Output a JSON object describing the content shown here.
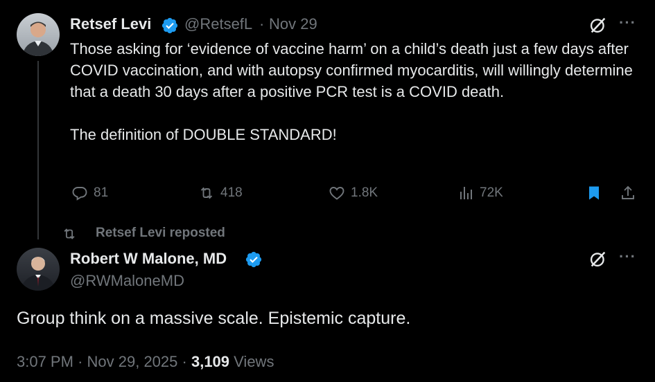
{
  "tweet1": {
    "author_name": "Retsef Levi",
    "handle": "@RetsefL",
    "separator": "·",
    "date": "Nov 29",
    "text_p1": "Those asking for ‘evidence of vaccine harm’ on a child’s death just a few days after COVID vaccination, and with autopsy confirmed myocarditis, will willingly determine that a death 30 days after a positive PCR test is a COVID death.",
    "text_p2": "The definition of DOUBLE STANDARD!",
    "replies": "81",
    "reposts": "418",
    "likes": "1.8K",
    "views": "72K",
    "more": "···"
  },
  "repost_label": "Retsef Levi reposted",
  "tweet2": {
    "author_name": "Robert W Malone, MD",
    "handle": "@RWMaloneMD",
    "text": "Group think on a massive scale.  Epistemic capture.",
    "time": "3:07 PM",
    "sep1": "·",
    "date": "Nov 29, 2025",
    "sep2": "·",
    "views_count": "3,109",
    "views_label": "Views",
    "more": "···"
  },
  "colors": {
    "background": "#000000",
    "text": "#e7e9ea",
    "muted": "#71767b",
    "verified": "#1d9bf0",
    "bookmark": "#1d9bf0"
  },
  "icons": [
    "verified-badge-icon",
    "reply-icon",
    "repost-icon",
    "like-icon",
    "views-icon",
    "bookmark-icon",
    "share-icon",
    "grok-icon",
    "more-icon"
  ]
}
